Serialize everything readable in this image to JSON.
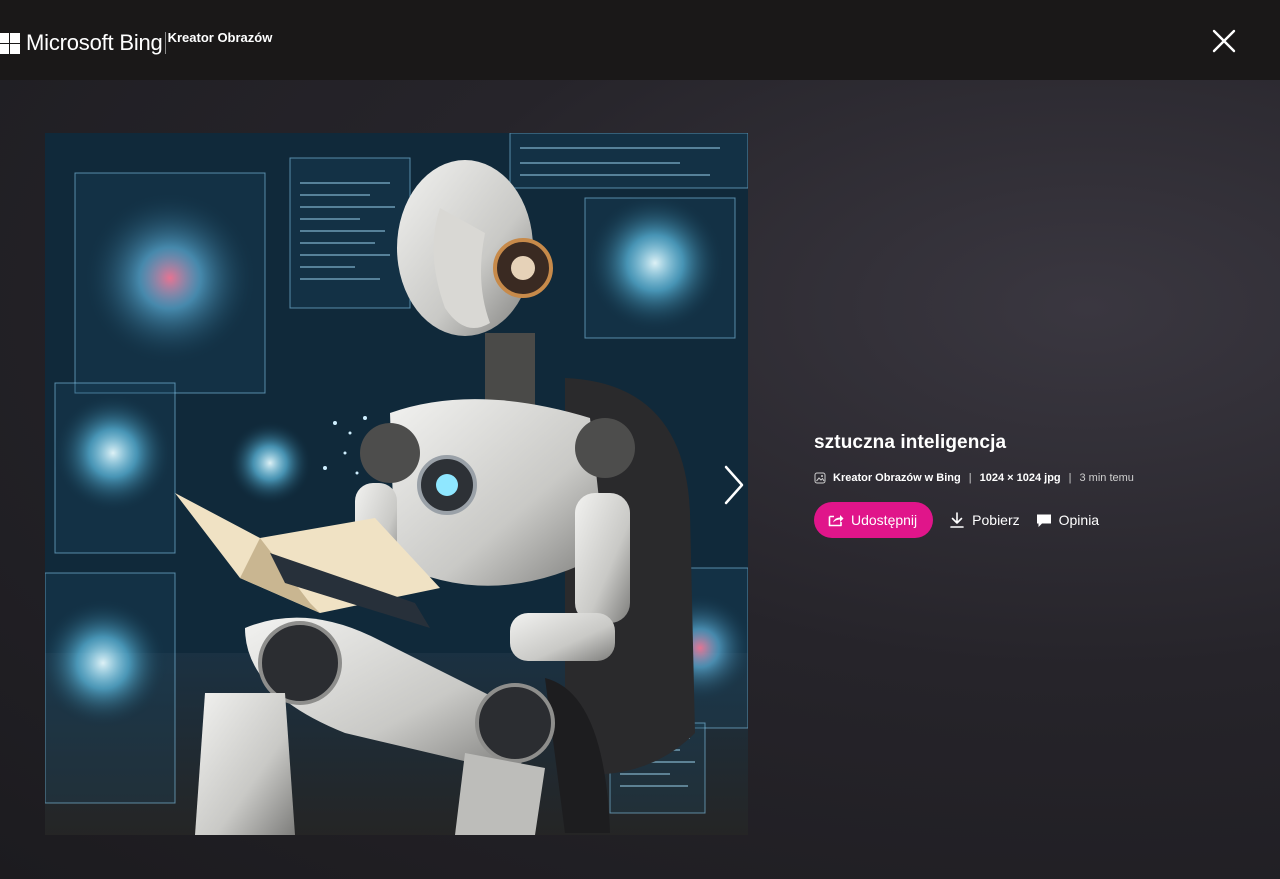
{
  "header": {
    "brand_name": "Microsoft Bing",
    "product_name": "Kreator Obrazów",
    "close_icon": "close-icon"
  },
  "image": {
    "alt": "sztuczna inteligencja",
    "next_icon": "chevron-right-icon"
  },
  "details": {
    "title": "sztuczna inteligencja",
    "source_icon": "image-creator-icon",
    "source": "Kreator Obrazów w Bing",
    "separator": "|",
    "dimensions": "1024 × 1024 jpg",
    "time": "3 min temu"
  },
  "actions": {
    "share_label": "Udostępnij",
    "share_icon": "share-icon",
    "download_label": "Pobierz",
    "download_icon": "download-icon",
    "feedback_label": "Opinia",
    "feedback_icon": "feedback-icon"
  },
  "colors": {
    "accent": "#e0158a",
    "topbar": "#1a1818",
    "background": "#26242a"
  }
}
